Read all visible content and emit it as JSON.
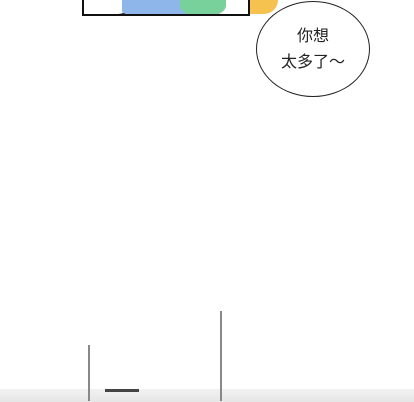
{
  "speech_bubble": {
    "line1": "你想",
    "line2": "太多了～"
  }
}
